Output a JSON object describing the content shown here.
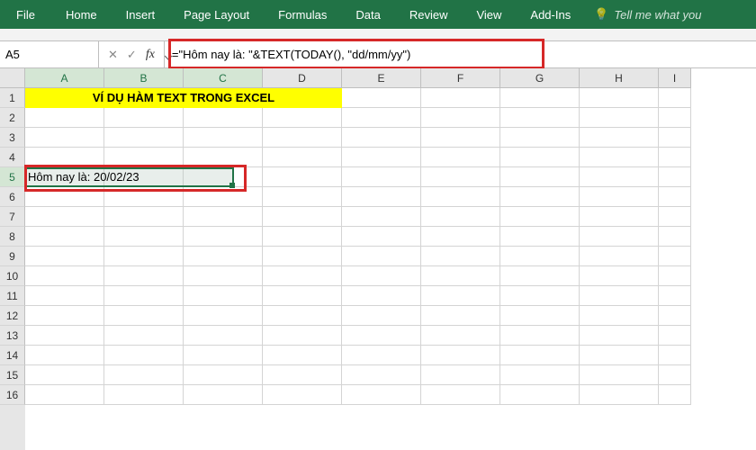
{
  "ribbon": {
    "file": "File",
    "tabs": [
      "Home",
      "Insert",
      "Page Layout",
      "Formulas",
      "Data",
      "Review",
      "View",
      "Add-Ins"
    ],
    "tell_me": "Tell me what you"
  },
  "name_box": {
    "value": "A5"
  },
  "fx": {
    "cancel": "✕",
    "confirm": "✓",
    "label": "fx"
  },
  "formula_bar": {
    "value": "=\"Hôm nay là: \"&TEXT(TODAY(), \"dd/mm/yy\")"
  },
  "columns": [
    "A",
    "B",
    "C",
    "D",
    "E",
    "F",
    "G",
    "H",
    "I"
  ],
  "rows": [
    1,
    2,
    3,
    4,
    5,
    6,
    7,
    8,
    9,
    10,
    11,
    12,
    13,
    14,
    15,
    16
  ],
  "title_text": "VÍ DỤ HÀM TEXT TRONG EXCEL",
  "a5_display": "Hôm nay là: 20/02/23",
  "active": {
    "cell": "A5",
    "row": 5,
    "cols": [
      "A",
      "B",
      "C"
    ]
  }
}
